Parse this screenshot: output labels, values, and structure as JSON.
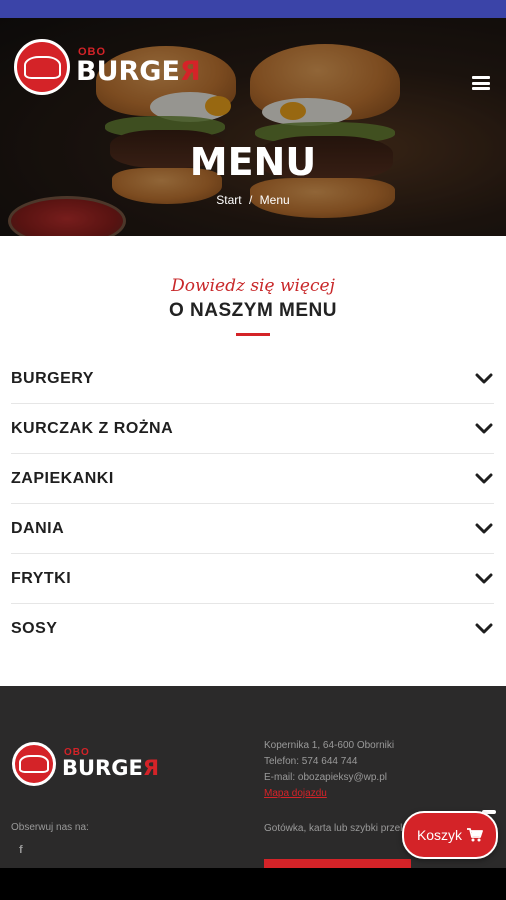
{
  "brand": {
    "logo_small": "OBO",
    "logo_big_main": "BURGE",
    "logo_big_accent": "Я"
  },
  "hero": {
    "title": "MENU",
    "breadcrumb": {
      "home": "Start",
      "separator": "/",
      "current": "Menu"
    }
  },
  "section": {
    "subtitle": "Dowiedz się więcej",
    "title": "O NASZYM MENU"
  },
  "menu": {
    "items": [
      {
        "label": "BURGERY"
      },
      {
        "label": "KURCZAK Z ROŻNA"
      },
      {
        "label": "ZAPIEKANKI"
      },
      {
        "label": "DANIA"
      },
      {
        "label": "FRYTKI"
      },
      {
        "label": "SOSY"
      }
    ]
  },
  "footer": {
    "follow_label": "Obserwuj nas na:",
    "facebook_glyph": "f",
    "address": "Kopernika 1, 64-600 Oborniki",
    "phone": "Telefon: 574 644 744",
    "email": "E-mail: obozapieksy@wp.pl",
    "privacy_link": "Mapa dojazdu",
    "payment": "Gotówka, karta lub szybki przelew"
  },
  "cart": {
    "label": "Koszyk",
    "icon": "cart-icon"
  },
  "colors": {
    "accent": "#d42328",
    "status_bar": "#3b44a8",
    "footer_bg": "#2b2a2a"
  }
}
